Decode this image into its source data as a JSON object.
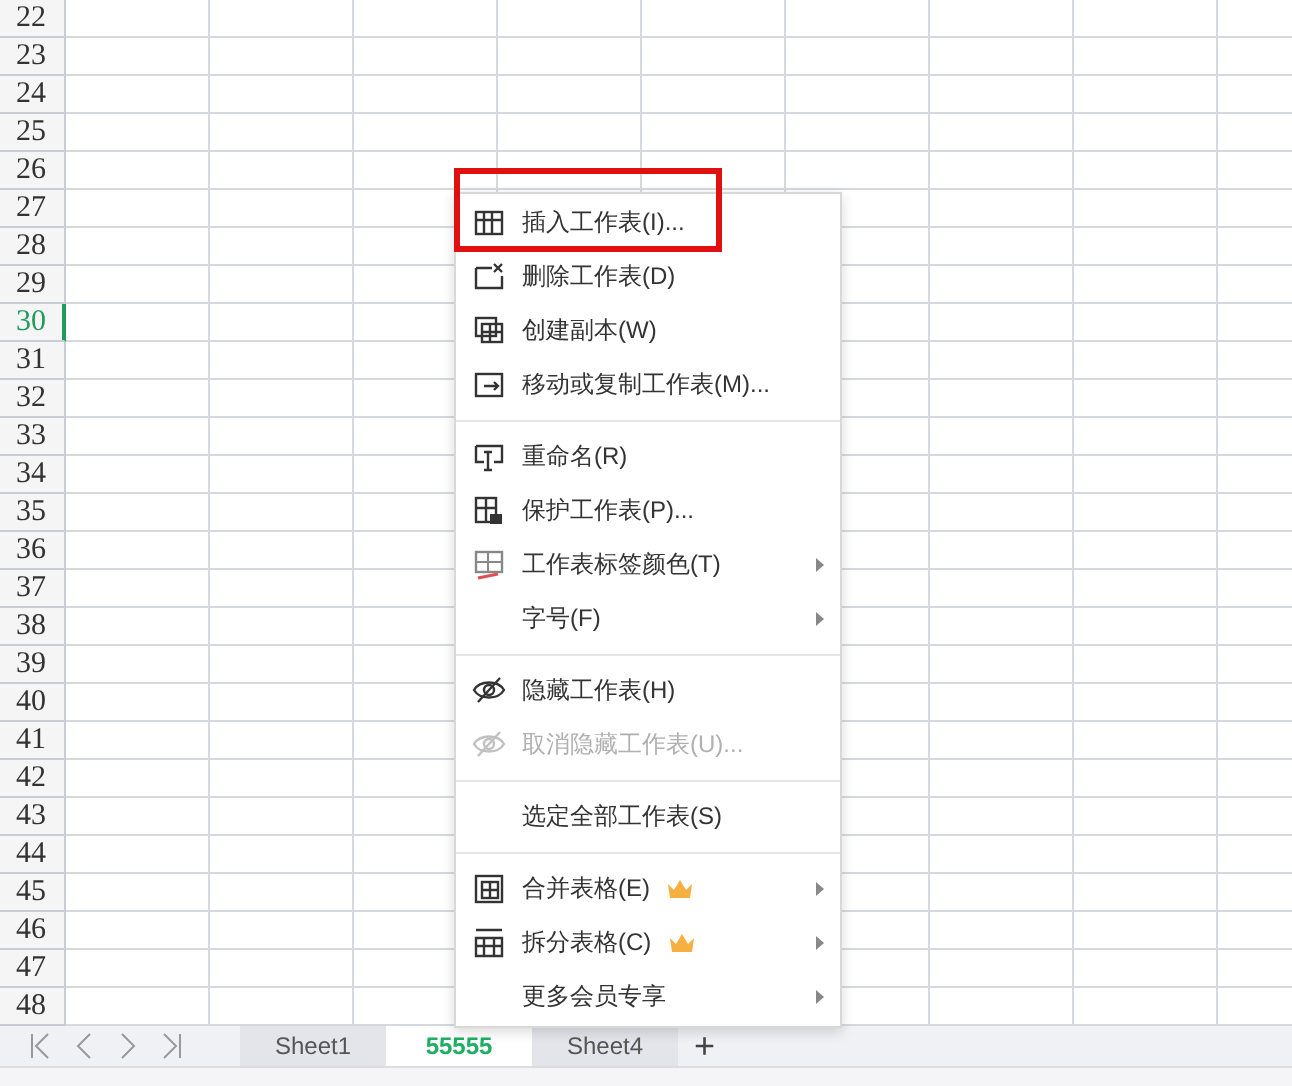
{
  "rows": [
    {
      "number": "22",
      "selected": false
    },
    {
      "number": "23",
      "selected": false
    },
    {
      "number": "24",
      "selected": false
    },
    {
      "number": "25",
      "selected": false
    },
    {
      "number": "26",
      "selected": false
    },
    {
      "number": "27",
      "selected": false
    },
    {
      "number": "28",
      "selected": false
    },
    {
      "number": "29",
      "selected": false
    },
    {
      "number": "30",
      "selected": true
    },
    {
      "number": "31",
      "selected": false
    },
    {
      "number": "32",
      "selected": false
    },
    {
      "number": "33",
      "selected": false
    },
    {
      "number": "34",
      "selected": false
    },
    {
      "number": "35",
      "selected": false
    },
    {
      "number": "36",
      "selected": false
    },
    {
      "number": "37",
      "selected": false
    },
    {
      "number": "38",
      "selected": false
    },
    {
      "number": "39",
      "selected": false
    },
    {
      "number": "40",
      "selected": false
    },
    {
      "number": "41",
      "selected": false
    },
    {
      "number": "42",
      "selected": false
    },
    {
      "number": "43",
      "selected": false
    },
    {
      "number": "44",
      "selected": false
    },
    {
      "number": "45",
      "selected": false
    },
    {
      "number": "46",
      "selected": false
    },
    {
      "number": "47",
      "selected": false
    },
    {
      "number": "48",
      "selected": false
    }
  ],
  "context_menu": {
    "items": [
      {
        "kind": "item",
        "label": "插入工作表(I)...",
        "highlighted": true,
        "disabled": false,
        "submenu": false,
        "member": false
      },
      {
        "kind": "item",
        "label": "删除工作表(D)",
        "highlighted": false,
        "disabled": false,
        "submenu": false,
        "member": false
      },
      {
        "kind": "item",
        "label": "创建副本(W)",
        "highlighted": false,
        "disabled": false,
        "submenu": false,
        "member": false
      },
      {
        "kind": "item",
        "label": "移动或复制工作表(M)...",
        "highlighted": false,
        "disabled": false,
        "submenu": false,
        "member": false
      },
      {
        "kind": "separator"
      },
      {
        "kind": "item",
        "label": "重命名(R)",
        "highlighted": false,
        "disabled": false,
        "submenu": false,
        "member": false
      },
      {
        "kind": "item",
        "label": "保护工作表(P)...",
        "highlighted": false,
        "disabled": false,
        "submenu": false,
        "member": false
      },
      {
        "kind": "item",
        "label": "工作表标签颜色(T)",
        "highlighted": false,
        "disabled": false,
        "submenu": true,
        "member": false
      },
      {
        "kind": "item",
        "label": "字号(F)",
        "highlighted": false,
        "disabled": false,
        "submenu": true,
        "member": false
      },
      {
        "kind": "separator"
      },
      {
        "kind": "item",
        "label": "隐藏工作表(H)",
        "highlighted": false,
        "disabled": false,
        "submenu": false,
        "member": false
      },
      {
        "kind": "item",
        "label": "取消隐藏工作表(U)...",
        "highlighted": false,
        "disabled": true,
        "submenu": false,
        "member": false
      },
      {
        "kind": "separator"
      },
      {
        "kind": "item",
        "label": "选定全部工作表(S)",
        "highlighted": false,
        "disabled": false,
        "submenu": false,
        "member": false
      },
      {
        "kind": "separator"
      },
      {
        "kind": "item",
        "label": "合并表格(E)",
        "highlighted": false,
        "disabled": false,
        "submenu": true,
        "member": true
      },
      {
        "kind": "item",
        "label": "拆分表格(C)",
        "highlighted": false,
        "disabled": false,
        "submenu": true,
        "member": true
      },
      {
        "kind": "item",
        "label": "更多会员专享",
        "highlighted": false,
        "disabled": false,
        "submenu": true,
        "member": false
      }
    ]
  },
  "sheet_tabs": [
    {
      "label": "Sheet1",
      "selected": false
    },
    {
      "label": "55555",
      "selected": true
    },
    {
      "label": "Sheet4",
      "selected": false
    }
  ],
  "add_sheet": "+"
}
